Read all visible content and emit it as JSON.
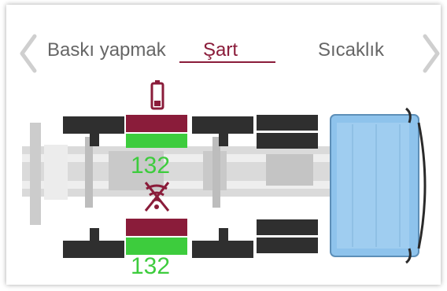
{
  "tabs": [
    {
      "label": "Baskı yapmak",
      "active": false
    },
    {
      "label": "Şart",
      "active": true
    },
    {
      "label": "Sıcaklık",
      "active": false
    }
  ],
  "nav": {
    "prev_icon": "chevron-left-icon",
    "next_icon": "chevron-right-icon"
  },
  "truck": {
    "selected_axle_index": 1,
    "left_tire_pressure": "132",
    "right_tire_pressure": "132",
    "sensor_icon": "low-battery-icon",
    "signal_icon": "no-signal-icon",
    "colors": {
      "accent": "#8a1c3a",
      "ok": "#3dcc3d",
      "tire": "#2f2f2f",
      "cab": "#8ec3ec",
      "chassis": "#d8d8d8"
    }
  }
}
